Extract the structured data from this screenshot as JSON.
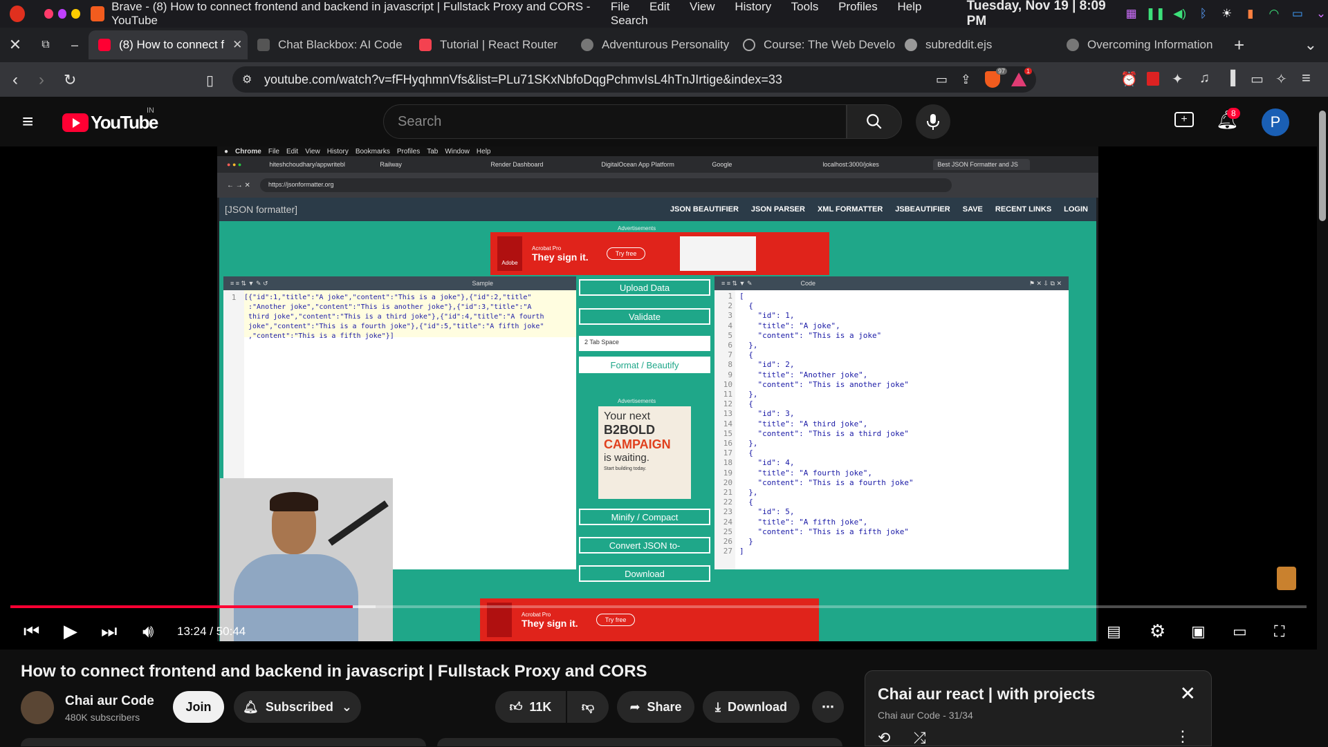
{
  "os": {
    "title": "Brave - (8) How to connect frontend and backend in javascript | Fullstack Proxy and CORS - YouTube",
    "menu": [
      "File",
      "Edit",
      "View",
      "History",
      "Tools",
      "Profiles",
      "Help",
      "Search"
    ],
    "clock": "Tuesday, Nov 19 | 8:09 PM"
  },
  "tabs": [
    {
      "label": "(8) How to connect f",
      "color": "#ff0033"
    },
    {
      "label": "Chat Blackbox: AI Code",
      "color": "#444444"
    },
    {
      "label": "Tutorial | React Router",
      "color": "#f44250"
    },
    {
      "label": "Adventurous Personality",
      "color": "#888888"
    },
    {
      "label": "Course: The Web Develo",
      "color": "#666666"
    },
    {
      "label": "subreddit.ejs",
      "color": "#888888"
    },
    {
      "label": "Overcoming Information",
      "color": "#888888"
    }
  ],
  "address": {
    "url": "youtube.com/watch?v=fFHyqhmnVfs&list=PLu71SKxNbfoDqgPchmvIsL4hTnJIrtige&index=33",
    "shields_badge": "97",
    "alert_badge": "1"
  },
  "yt": {
    "logo": "YouTube",
    "region": "IN",
    "search_placeholder": "Search",
    "notif_count": "8",
    "avatar_letter": "P"
  },
  "inner": {
    "mac_menu": [
      "Chrome",
      "File",
      "Edit",
      "View",
      "History",
      "Bookmarks",
      "Profiles",
      "Tab",
      "Window",
      "Help"
    ],
    "tabs": [
      "hiteshchoudhary/appwritebl",
      "Railway",
      "Render Dashboard",
      "DigitalOcean App Platform",
      "Google",
      "localhost:3000/jokes",
      "Best JSON Formatter and JS"
    ],
    "url": "https://jsonformatter.org",
    "site_logo": "[JSON formatter]",
    "site_nav": [
      "JSON BEAUTIFIER",
      "JSON PARSER",
      "XML FORMATTER",
      "JSBEAUTIFIER",
      "SAVE",
      "RECENT LINKS",
      "LOGIN"
    ],
    "ad_label": "Advertisements",
    "ad_brand": "Acrobat Pro",
    "ad_text": "They sign it.",
    "ad_cta": "Try free",
    "left_panel_label": "Sample",
    "input_json": "[{\"id\":1,\"title\":\"A joke\",\"content\":\"This is a joke\"},{\"id\":2,\"title\"\n :\"Another joke\",\"content\":\"This is another joke\"},{\"id\":3,\"title\":\"A\n third joke\",\"content\":\"This is a third joke\"},{\"id\":4,\"title\":\"A fourth\n joke\",\"content\":\"This is a fourth joke\"},{\"id\":5,\"title\":\"A fifth joke\"\n ,\"content\":\"This is a fifth joke\"}]",
    "buttons": [
      "Upload Data",
      "Validate",
      "Format / Beautify",
      "Minify / Compact",
      "Convert JSON to-",
      "Download"
    ],
    "tab_space": "2 Tab Space",
    "ad2_lines": [
      "Your next",
      "B2BOLD",
      "CAMPAIGN",
      "is waiting."
    ],
    "ad2_sub": "Start building today.",
    "right_panel_label": "Code",
    "line_numbers": [
      "1",
      "2",
      "3",
      "4",
      "5",
      "6",
      "7",
      "8",
      "9",
      "10",
      "11",
      "12",
      "13",
      "14",
      "15",
      "16",
      "17",
      "18",
      "19",
      "20",
      "21",
      "22",
      "23",
      "24",
      "25",
      "26",
      "27"
    ],
    "output_json": "[\n  {\n    \"id\": 1,\n    \"title\": \"A joke\",\n    \"content\": \"This is a joke\"\n  },\n  {\n    \"id\": 2,\n    \"title\": \"Another joke\",\n    \"content\": \"This is another joke\"\n  },\n  {\n    \"id\": 3,\n    \"title\": \"A third joke\",\n    \"content\": \"This is a third joke\"\n  },\n  {\n    \"id\": 4,\n    \"title\": \"A fourth joke\",\n    \"content\": \"This is a fourth joke\"\n  },\n  {\n    \"id\": 5,\n    \"title\": \"A fifth joke\",\n    \"content\": \"This is a fifth joke\"\n  }\n]"
  },
  "player": {
    "time": "13:24 / 50:44",
    "played_fraction": 0.264,
    "loaded_fraction": 0.282
  },
  "video": {
    "title": "How to connect frontend and backend in javascript | Fullstack Proxy and CORS",
    "channel": "Chai aur Code",
    "subscribers": "480K subscribers",
    "join": "Join",
    "subscribed": "Subscribed",
    "likes": "11K",
    "share": "Share",
    "download": "Download"
  },
  "playlist": {
    "title": "Chai aur react | with projects",
    "sub": "Chai aur Code - 31/34"
  },
  "colors": {
    "yt_red": "#ff0033",
    "jsonformatter_green": "#1fa789",
    "adobe_red": "#e0231b"
  }
}
